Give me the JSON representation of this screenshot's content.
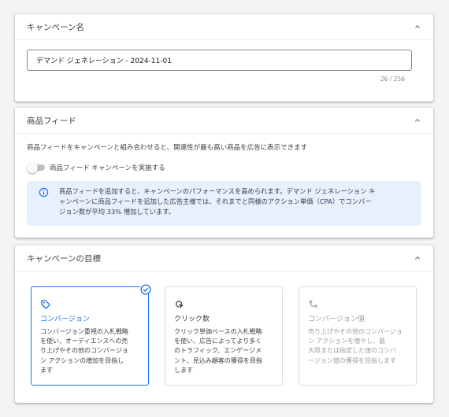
{
  "campaign_name": {
    "title": "キャンペーン名",
    "value": "デマンド ジェネレーション - 2024-11-01",
    "counter": "26 / 256"
  },
  "product_feed": {
    "title": "商品フィード",
    "description": "商品フィードをキャンペーンと組み合わせると、関連性が最も高い商品を広告に表示できます",
    "toggle_label": "商品フィード キャンペーンを実施する",
    "toggle_on": false,
    "info_lines": [
      "商品フィードを追加すると、キャンペーンのパフォーマンスを高められます。デマンド ジェネレーション キ",
      "ャンペーンに商品フィードを追加した広告主様では、それまでと同様のアクション単価（CPA）でコンバー",
      "ジョン数が平均 33% 増加しています。"
    ]
  },
  "campaign_goal": {
    "title": "キャンペーンの目標",
    "goals": [
      {
        "title": "コンバージョン",
        "desc_lines": [
          "コンバージョン重視の入札戦略",
          "を使い、オーディエンスへの売",
          "り上げやその他のコンバージョ",
          "ン アクションの増加を目指し",
          "ます"
        ],
        "icon": "tag-icon",
        "state": "selected"
      },
      {
        "title": "クリック数",
        "desc_lines": [
          "クリック単価ベースの入札戦略",
          "を使い、広告によってより多く",
          "のトラフィック、エンゲージメ",
          "ント、見込み顧客の獲得を目指",
          "します"
        ],
        "icon": "cursor-click-icon",
        "state": "normal"
      },
      {
        "title": "コンバージョン値",
        "desc_lines": [
          "売り上げやその他のコンバージョ",
          "ン アクションを増やし、最",
          "大限または指定した値のコンバ",
          "ージョン値の獲得を目指します"
        ],
        "icon": "conversion-value-icon",
        "state": "disabled"
      }
    ]
  },
  "colors": {
    "accent": "#1a73e8",
    "info_bg": "#e8f0fe",
    "page_bg": "#f1f3f4",
    "disabled_text": "#9aa0a6"
  }
}
